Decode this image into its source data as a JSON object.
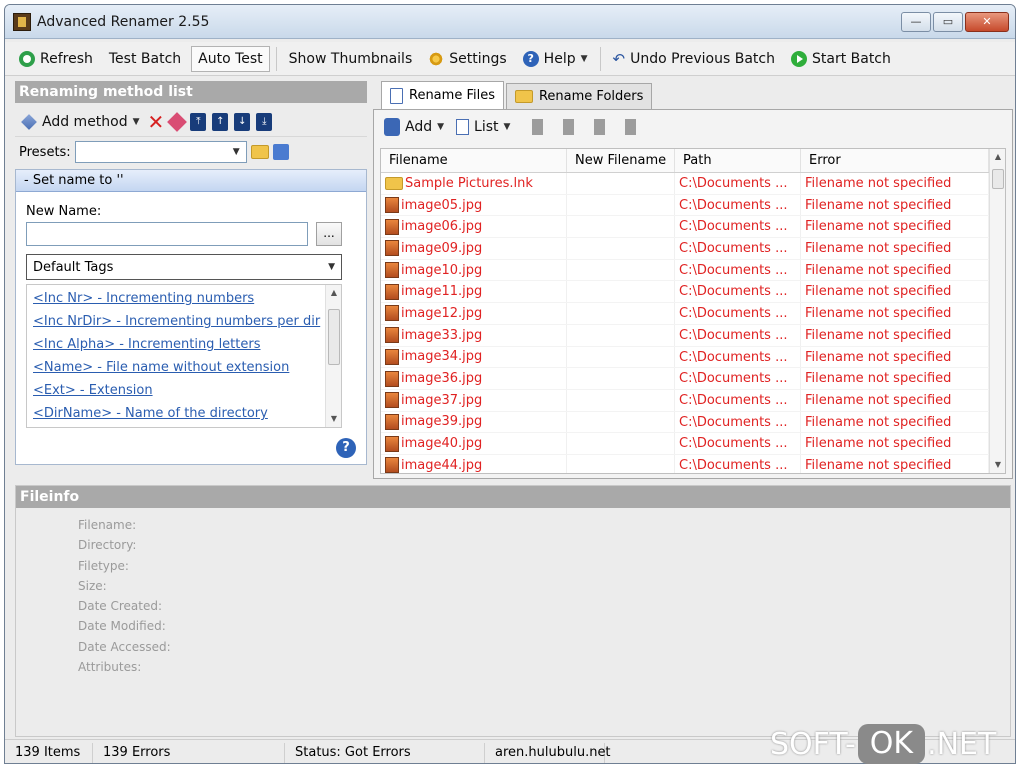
{
  "window": {
    "title": "Advanced Renamer 2.55"
  },
  "toolbar": {
    "refresh": "Refresh",
    "test_batch": "Test Batch",
    "auto_test": "Auto Test",
    "show_thumbnails": "Show Thumbnails",
    "settings": "Settings",
    "help": "Help",
    "undo": "Undo Previous Batch",
    "start": "Start Batch"
  },
  "left_panel": {
    "header": "Renaming method list",
    "add_method": "Add method",
    "presets_label": "Presets:",
    "presets_value": "",
    "method_title": "-  Set name to ''",
    "new_name_label": "New Name:",
    "new_name_value": "",
    "dots_label": "...",
    "tags_combo": "Default Tags",
    "tags": [
      "<Inc Nr> - Incrementing numbers",
      "<Inc NrDir> - Incrementing numbers per dir",
      "<Inc Alpha> - Incrementing letters",
      "<Name> - File name without extension",
      "<Ext> - Extension",
      "<DirName> - Name of the directory"
    ]
  },
  "right_panel": {
    "tabs": [
      "Rename Files",
      "Rename Folders"
    ],
    "add": "Add",
    "list": "List",
    "columns": [
      "Filename",
      "New Filename",
      "Path",
      "Error"
    ],
    "rows": [
      {
        "name": "Sample Pictures.lnk",
        "new": "",
        "path": "C:\\Documents ...",
        "error": "Filename not specified",
        "kind": "folder"
      },
      {
        "name": "image05.jpg",
        "new": "",
        "path": "C:\\Documents ...",
        "error": "Filename not specified",
        "kind": "file"
      },
      {
        "name": "image06.jpg",
        "new": "",
        "path": "C:\\Documents ...",
        "error": "Filename not specified",
        "kind": "file"
      },
      {
        "name": "image09.jpg",
        "new": "",
        "path": "C:\\Documents ...",
        "error": "Filename not specified",
        "kind": "file"
      },
      {
        "name": "image10.jpg",
        "new": "",
        "path": "C:\\Documents ...",
        "error": "Filename not specified",
        "kind": "file"
      },
      {
        "name": "image11.jpg",
        "new": "",
        "path": "C:\\Documents ...",
        "error": "Filename not specified",
        "kind": "file"
      },
      {
        "name": "image12.jpg",
        "new": "",
        "path": "C:\\Documents ...",
        "error": "Filename not specified",
        "kind": "file"
      },
      {
        "name": "image33.jpg",
        "new": "",
        "path": "C:\\Documents ...",
        "error": "Filename not specified",
        "kind": "file"
      },
      {
        "name": "image34.jpg",
        "new": "",
        "path": "C:\\Documents ...",
        "error": "Filename not specified",
        "kind": "file"
      },
      {
        "name": "image36.jpg",
        "new": "",
        "path": "C:\\Documents ...",
        "error": "Filename not specified",
        "kind": "file"
      },
      {
        "name": "image37.jpg",
        "new": "",
        "path": "C:\\Documents ...",
        "error": "Filename not specified",
        "kind": "file"
      },
      {
        "name": "image39.jpg",
        "new": "",
        "path": "C:\\Documents ...",
        "error": "Filename not specified",
        "kind": "file"
      },
      {
        "name": "image40.jpg",
        "new": "",
        "path": "C:\\Documents ...",
        "error": "Filename not specified",
        "kind": "file"
      },
      {
        "name": "image44.jpg",
        "new": "",
        "path": "C:\\Documents ...",
        "error": "Filename not specified",
        "kind": "file"
      }
    ]
  },
  "fileinfo": {
    "header": "Fileinfo",
    "labels": [
      "Filename:",
      "Directory:",
      "Filetype:",
      "Size:",
      "Date Created:",
      "Date Modified:",
      "Date Accessed:",
      "Attributes:"
    ]
  },
  "status": {
    "items": "139 Items",
    "errors": "139 Errors",
    "status": "Status: Got Errors",
    "site": "aren.hulubulu.net"
  },
  "watermark": {
    "left": "SOFT-",
    "ok": "OK",
    "right": ".NET"
  },
  "colors": {
    "error_text": "#e02222",
    "panel_header": "#a9a9a9",
    "link": "#2a5db0"
  }
}
